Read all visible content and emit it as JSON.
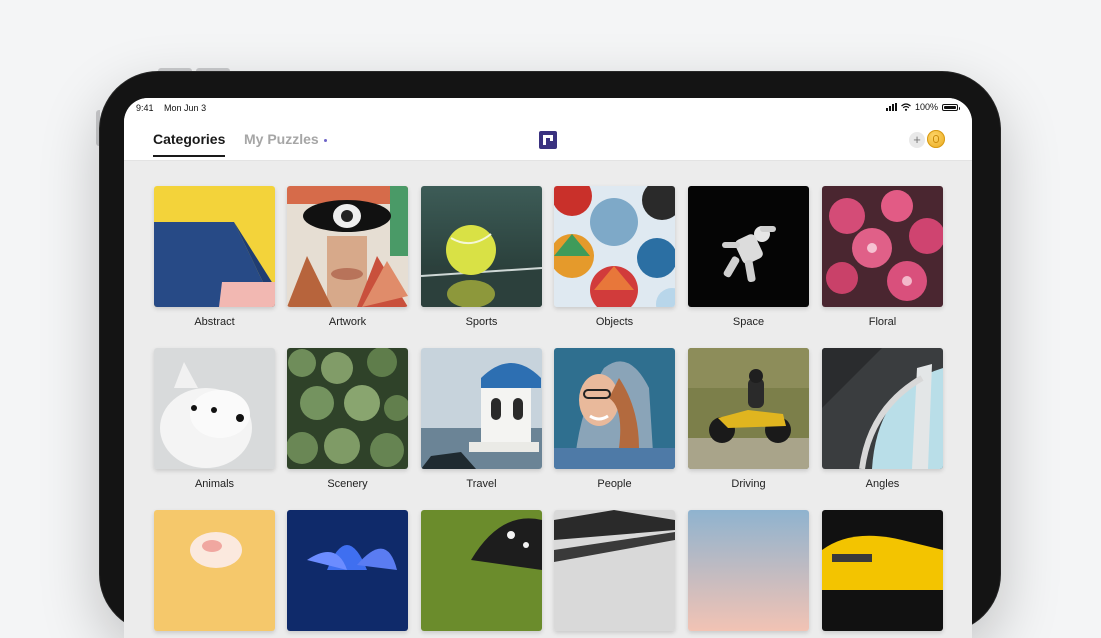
{
  "status_bar": {
    "time": "9:41",
    "date": "Mon Jun 3",
    "battery": "100%"
  },
  "nav": {
    "tabs": [
      {
        "label": "Categories",
        "active": true
      },
      {
        "label": "My Puzzles",
        "active": false,
        "has_indicator": true
      }
    ],
    "logo_icon": "puzzle-logo-icon",
    "add_icon": "plus-icon",
    "plus_glyph": "+",
    "coin_icon": "coin-icon"
  },
  "colors": {
    "accent": "#3a3280",
    "indicator": "#6e64c8",
    "coin": "#f2b632"
  },
  "categories": [
    {
      "label": "Abstract"
    },
    {
      "label": "Artwork"
    },
    {
      "label": "Sports"
    },
    {
      "label": "Objects"
    },
    {
      "label": "Space"
    },
    {
      "label": "Floral"
    },
    {
      "label": "Animals"
    },
    {
      "label": "Scenery"
    },
    {
      "label": "Travel"
    },
    {
      "label": "People"
    },
    {
      "label": "Driving"
    },
    {
      "label": "Angles"
    }
  ]
}
